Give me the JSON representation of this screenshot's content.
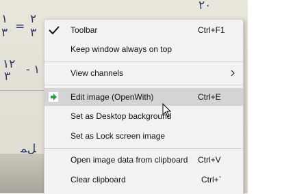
{
  "menu": {
    "items": [
      {
        "label": "Toolbar",
        "shortcut": "Ctrl+F1",
        "checked": true,
        "icon": "check-icon"
      },
      {
        "label": "Keep window always on top",
        "shortcut": ""
      },
      {
        "label": "View channels",
        "shortcut": "",
        "submenu": true,
        "icon": "chevron-right-icon"
      },
      {
        "label": "Edit image (OpenWith)",
        "shortcut": "Ctrl+E",
        "highlighted": true,
        "icon": "open-with-arrow-icon"
      },
      {
        "label": "Set as Desktop background",
        "shortcut": ""
      },
      {
        "label": "Set as Lock screen image",
        "shortcut": ""
      },
      {
        "label": "Open image data from clipboard",
        "shortcut": "Ctrl+V"
      },
      {
        "label": "Clear clipboard",
        "shortcut": "Ctrl+`"
      }
    ]
  },
  "colors": {
    "menu_bg": "#f2f2f2",
    "highlight_bg": "#d4d4d4",
    "open_with_icon": "#21a336"
  }
}
